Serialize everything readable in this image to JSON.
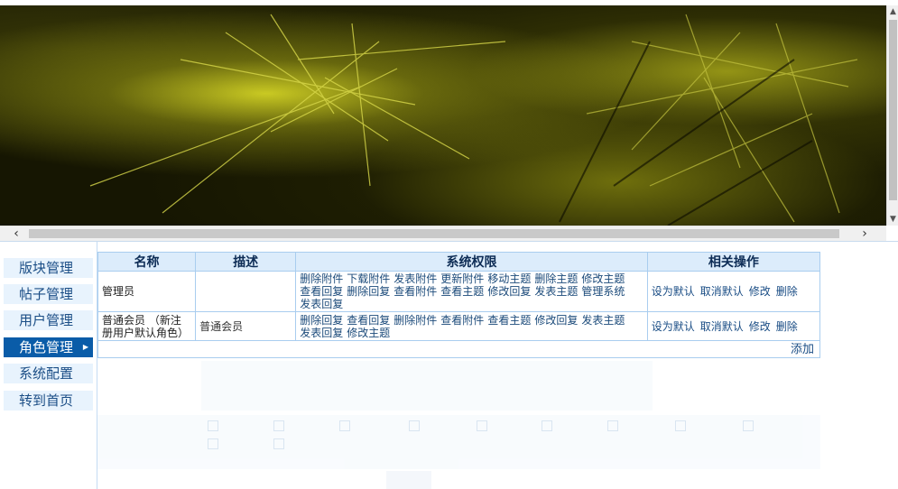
{
  "sidebar": {
    "items": [
      {
        "label": "版块管理",
        "active": false
      },
      {
        "label": "帖子管理",
        "active": false
      },
      {
        "label": "用户管理",
        "active": false
      },
      {
        "label": "角色管理",
        "active": true
      },
      {
        "label": "系统配置",
        "active": false
      },
      {
        "label": "转到首页",
        "active": false
      }
    ]
  },
  "table": {
    "headers": [
      "名称",
      "描述",
      "系统权限",
      "相关操作"
    ],
    "rows": [
      {
        "name": "管理员",
        "description": "",
        "permissions": [
          "删除附件",
          "下载附件",
          "发表附件",
          "更新附件",
          "移动主题",
          "删除主题",
          "修改主题",
          "查看回复",
          "删除回复",
          "查看附件",
          "查看主题",
          "修改回复",
          "发表主题",
          "管理系统",
          "发表回复"
        ],
        "actions": [
          "设为默认",
          "取消默认",
          "修改",
          "删除"
        ]
      },
      {
        "name": "普通会员 （新注册用户默认角色）",
        "description": "普通会员",
        "permissions": [
          "删除回复",
          "查看回复",
          "删除附件",
          "查看附件",
          "查看主题",
          "修改回复",
          "发表主题",
          "发表回复",
          "修改主题"
        ],
        "actions": [
          "设为默认",
          "取消默认",
          "修改",
          "删除"
        ]
      }
    ],
    "add_label": "添加"
  },
  "colors": {
    "accent": "#0a5ca8",
    "header_bg": "#dcecfb",
    "border": "#a9cdef",
    "nav_bg": "#e8f3fd"
  }
}
